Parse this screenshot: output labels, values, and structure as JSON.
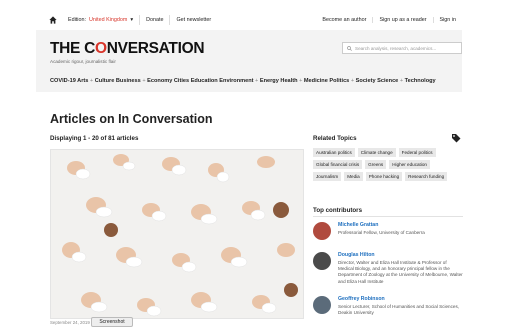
{
  "topbar": {
    "edition_label": "Edition:",
    "edition_value": "United Kingdom",
    "donate": "Donate",
    "newsletter": "Get newsletter",
    "become_author": "Become an author",
    "signup_reader": "Sign up as a reader",
    "signin": "Sign in"
  },
  "masthead": {
    "logo_left": "THE C",
    "logo_o": "O",
    "logo_right": "NVERSATION",
    "tagline": "Academic rigour, journalistic flair",
    "search_placeholder": "Search analysis, research, academics..."
  },
  "nav": {
    "items": [
      "COVID-19",
      "Arts",
      "Culture",
      "Business",
      "Economy",
      "Cities",
      "Education",
      "Environment",
      "Energy",
      "Health",
      "Medicine",
      "Politics",
      "Society",
      "Science",
      "Technology"
    ]
  },
  "main": {
    "title": "Articles on In Conversation",
    "displaying": "Displaying 1 - 20 of 81 articles",
    "hero_caption": "September 24, 2019",
    "screenshot_label": "Screenshot"
  },
  "related": {
    "heading": "Related Topics",
    "tags": [
      [
        "Australian politics",
        "Climate change",
        "Federal politics"
      ],
      [
        "Global financial crisis",
        "Greens",
        "Higher education"
      ],
      [
        "Journalism",
        "Media",
        "Phone hacking",
        "Research funding"
      ]
    ]
  },
  "contributors": {
    "heading": "Top contributors",
    "people": [
      {
        "name": "Michelle Grattan",
        "role": "Professorial Fellow, University of Canberra",
        "avatar_color": "#b04a3e"
      },
      {
        "name": "Douglas Hilton",
        "role": "Director, Walter and Eliza Hall Institute & Professor of Medical Biology, and an honorary principal fellow in the Department of Zoology at the University of Melbourne, Walter and Eliza Hall Institute",
        "avatar_color": "#4a4a4a"
      },
      {
        "name": "Geoffrey Robinson",
        "role": "Senior Lecturer, School of Humanities and Social Sciences, Deakin University",
        "avatar_color": "#5b6b7a"
      }
    ]
  },
  "colors": {
    "accent_red": "#d8352a",
    "link_blue": "#1e6fbf"
  }
}
